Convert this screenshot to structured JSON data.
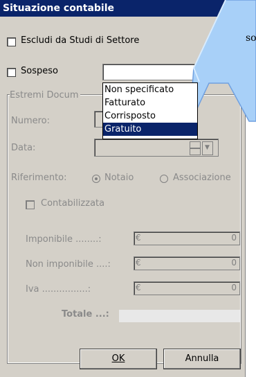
{
  "title": "Situazione contabile",
  "escludi_label": "Escludi da Studi di Settore",
  "sospeso_label": "Sospeso",
  "dropdown_items": [
    "Non specificato",
    "Fatturato",
    "Corrisposto",
    "Gratuito"
  ],
  "dropdown_selected": "Gratuito",
  "group_title": "Estremi Docum",
  "numero_label": "Numero:",
  "data_label": "Data:",
  "riferimento_label": "Riferimento:",
  "notaio_label": "Notaio",
  "associazione_label": "Associazione",
  "contabilizzata_label": "Contabilizzata",
  "imponibile_label": "Imponibile ........:",
  "non_imponibile_label": "Non imponibile ....:",
  "iva_label": "Iva ................:",
  "totale_label": "Totale ...:",
  "currency": "€",
  "imponibile_value": "0",
  "non_imponibile_value": "0",
  "iva_value": "0",
  "ok_label": "OK",
  "annulla_label": "Annulla",
  "callout_text": "so"
}
